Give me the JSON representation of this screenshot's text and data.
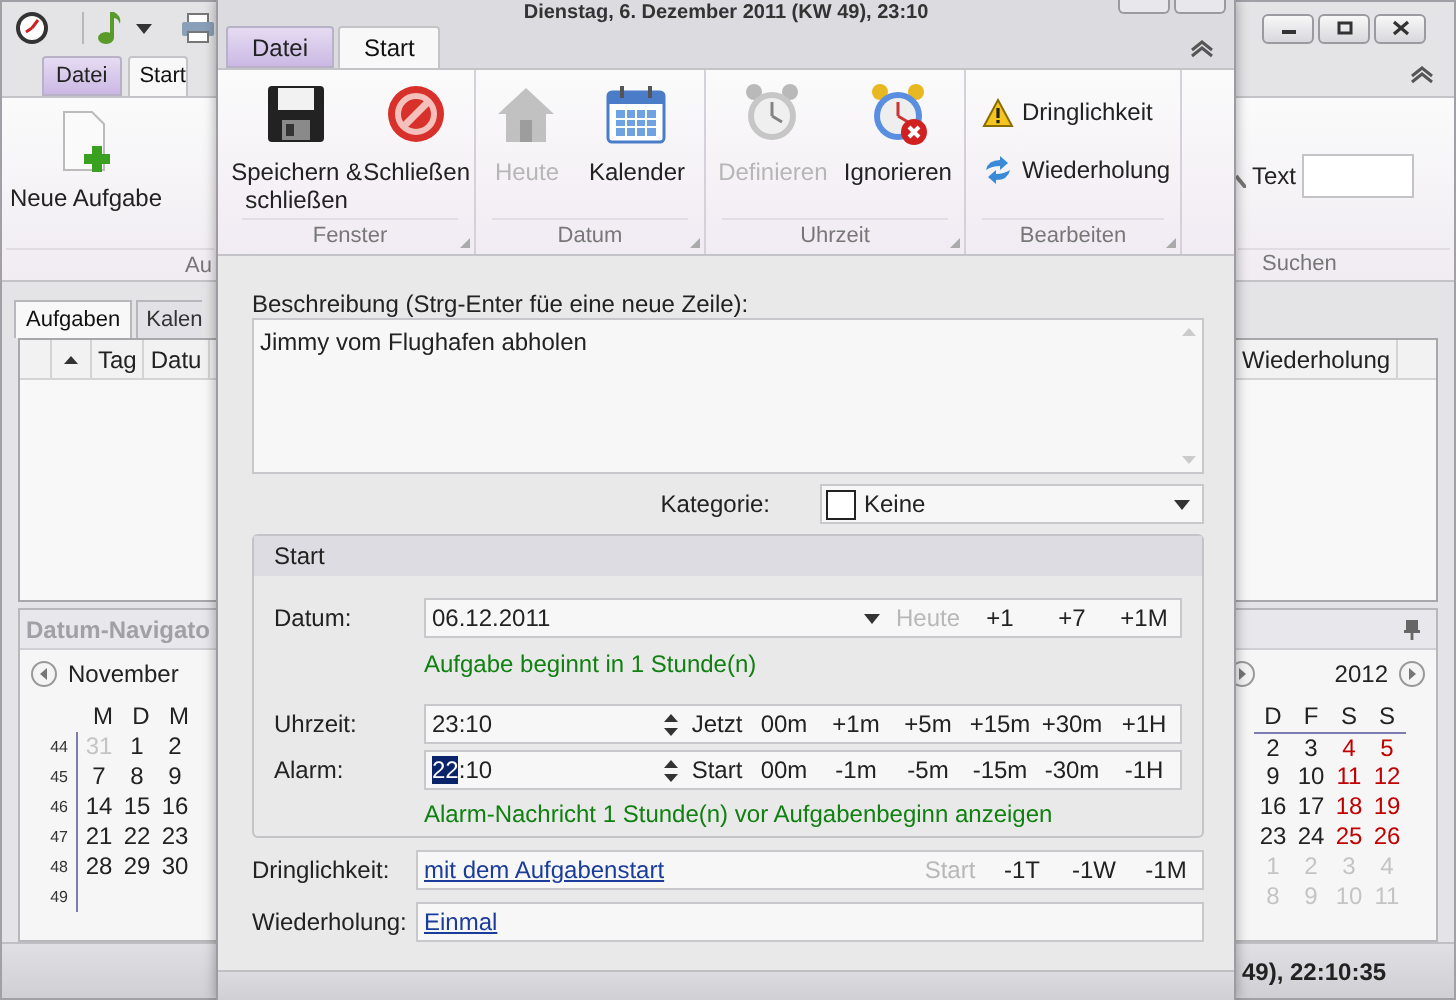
{
  "background_window": {
    "tabs": [
      {
        "label": "Datei",
        "kind": "app_menu",
        "selected": false
      },
      {
        "label": "Start",
        "kind": "tab",
        "selected": true
      }
    ],
    "new_task_button": "Neue Aufgabe",
    "ribbon_group": "Au",
    "search_label": "Text",
    "search_group": "Suchen",
    "view_tabs": [
      {
        "label": "Aufgaben",
        "selected": true
      },
      {
        "label": "Kalen",
        "selected": false
      }
    ],
    "table_columns": [
      "Tag",
      "Datu"
    ],
    "table_columns_right": [
      "Wiederholung"
    ],
    "navigator": {
      "title": "Datum-Navigato",
      "left_month": "November",
      "left_weekdays": [
        "M",
        "D",
        "M"
      ],
      "left_weeks": [
        {
          "week": "44",
          "days": [
            {
              "text": "31",
              "muted": true
            },
            {
              "text": "1",
              "muted": false
            },
            {
              "text": "2",
              "muted": false
            }
          ]
        },
        {
          "week": "45",
          "days": [
            {
              "text": "7",
              "muted": false
            },
            {
              "text": "8",
              "muted": false
            },
            {
              "text": "9",
              "muted": false
            }
          ]
        },
        {
          "week": "46",
          "days": [
            {
              "text": "14",
              "muted": false
            },
            {
              "text": "15",
              "muted": false
            },
            {
              "text": "16",
              "muted": false
            }
          ]
        },
        {
          "week": "47",
          "days": [
            {
              "text": "21",
              "muted": false
            },
            {
              "text": "22",
              "muted": false
            },
            {
              "text": "23",
              "muted": false
            }
          ]
        },
        {
          "week": "48",
          "days": [
            {
              "text": "28",
              "muted": false
            },
            {
              "text": "29",
              "muted": false
            },
            {
              "text": "30",
              "muted": false
            }
          ]
        },
        {
          "week": "49"
        }
      ],
      "right_year": "2012",
      "right_weekdays": [
        "D",
        "F",
        "S",
        "S"
      ],
      "right_weeks": [
        [
          {
            "text": "2",
            "muted": false
          },
          {
            "text": "3",
            "muted": false
          },
          {
            "text": "4",
            "muted": false
          },
          {
            "text": "5",
            "muted": false
          }
        ],
        [
          {
            "text": "9",
            "muted": false
          },
          {
            "text": "10",
            "muted": false
          },
          {
            "text": "11",
            "muted": false
          },
          {
            "text": "12",
            "muted": false
          }
        ],
        [
          {
            "text": "16",
            "muted": false
          },
          {
            "text": "17",
            "muted": false
          },
          {
            "text": "18",
            "muted": false
          },
          {
            "text": "19",
            "muted": false
          }
        ],
        [
          {
            "text": "23",
            "muted": false
          },
          {
            "text": "24",
            "muted": false
          },
          {
            "text": "25",
            "muted": false
          },
          {
            "text": "26",
            "muted": false
          }
        ],
        [
          {
            "text": "1",
            "muted": true
          },
          {
            "text": "2",
            "muted": true
          },
          {
            "text": "3",
            "muted": true
          },
          {
            "text": "4",
            "muted": true
          }
        ],
        [
          {
            "text": "8",
            "muted": true
          },
          {
            "text": "9",
            "muted": true
          },
          {
            "text": "10",
            "muted": true
          },
          {
            "text": "11",
            "muted": true
          }
        ]
      ]
    },
    "status": "49), 22:10:35"
  },
  "dialog": {
    "title": "Dienstag, 6. Dezember 2011 (KW 49), 23:10",
    "tabs": [
      {
        "label": "Datei",
        "kind": "app_menu",
        "selected": false
      },
      {
        "label": "Start",
        "kind": "tab",
        "selected": true
      }
    ],
    "ribbon_groups": [
      {
        "label": "Fenster",
        "kind": "large",
        "buttons": [
          {
            "label": "Speichern & schließen",
            "kind": "save",
            "disabled": false
          },
          {
            "label": "Schließen",
            "kind": "cancel",
            "disabled": false
          }
        ]
      },
      {
        "label": "Datum",
        "kind": "large",
        "buttons": [
          {
            "label": "Heute",
            "kind": "home",
            "disabled": true
          },
          {
            "label": "Kalender",
            "kind": "calendar",
            "disabled": false
          }
        ]
      },
      {
        "label": "Uhrzeit",
        "kind": "large",
        "buttons": [
          {
            "label": "Definieren",
            "kind": "alarm",
            "disabled": true
          },
          {
            "label": "Ignorieren",
            "kind": "alarm_off",
            "disabled": false
          }
        ]
      },
      {
        "label": "Bearbeiten",
        "kind": "small",
        "buttons": [
          {
            "label": "Dringlichkeit",
            "kind": "warning",
            "disabled": false
          },
          {
            "label": "Wiederholung",
            "kind": "repeat",
            "disabled": false
          }
        ]
      }
    ],
    "description": {
      "label": "Beschreibung (Strg-Enter füe eine neue Zeile):",
      "value": "Jimmy vom Flughafen abholen"
    },
    "category": {
      "label": "Kategorie:",
      "value": "Keine"
    },
    "start": {
      "title": "Start",
      "date": {
        "label": "Datum:",
        "value": "06.12.2011",
        "quick": [
          {
            "label": "Heute",
            "disabled": true
          },
          {
            "label": "+1",
            "disabled": false
          },
          {
            "label": "+7",
            "disabled": false
          },
          {
            "label": "+1M",
            "disabled": false
          }
        ]
      },
      "date_note": "Aufgabe beginnt in 1 Stunde(n)",
      "time": {
        "label": "Uhrzeit:",
        "value": "23:10",
        "quick": [
          {
            "label": "Jetzt",
            "disabled": false
          },
          {
            "label": "00m",
            "disabled": false
          },
          {
            "label": "+1m",
            "disabled": false
          },
          {
            "label": "+5m",
            "disabled": false
          },
          {
            "label": "+15m",
            "disabled": false
          },
          {
            "label": "+30m",
            "disabled": false
          },
          {
            "label": "+1H",
            "disabled": false
          }
        ]
      },
      "alarm": {
        "label": "Alarm:",
        "value_selected": "22",
        "value_rest": ":10",
        "quick": [
          {
            "label": "Start",
            "disabled": false
          },
          {
            "label": "00m",
            "disabled": false
          },
          {
            "label": "-1m",
            "disabled": false
          },
          {
            "label": "-5m",
            "disabled": false
          },
          {
            "label": "-15m",
            "disabled": false
          },
          {
            "label": "-30m",
            "disabled": false
          },
          {
            "label": "-1H",
            "disabled": false
          }
        ]
      },
      "alarm_note": "Alarm-Nachricht 1 Stunde(n) vor Aufgabenbeginn anzeigen"
    },
    "urgency": {
      "label": "Dringlichkeit:",
      "link": "mit dem Aufgabenstart",
      "quick": [
        {
          "label": "Start",
          "disabled": true
        },
        {
          "label": "-1T",
          "disabled": false
        },
        {
          "label": "-1W",
          "disabled": false
        },
        {
          "label": "-1M",
          "disabled": false
        }
      ]
    },
    "repeat": {
      "label": "Wiederholung:",
      "link": "Einmal"
    }
  }
}
